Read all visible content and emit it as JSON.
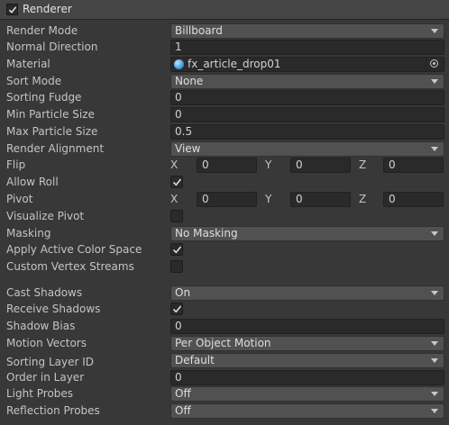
{
  "header": {
    "title": "Renderer",
    "checked": true
  },
  "rows": {
    "render_mode": {
      "label": "Render Mode",
      "value": "Billboard"
    },
    "normal_direction": {
      "label": "Normal Direction",
      "value": "1"
    },
    "material": {
      "label": "Material",
      "value": "fx_article_drop01",
      "icon": "material-sphere-icon"
    },
    "sort_mode": {
      "label": "Sort Mode",
      "value": "None"
    },
    "sorting_fudge": {
      "label": "Sorting Fudge",
      "value": "0"
    },
    "min_particle_size": {
      "label": "Min Particle Size",
      "value": "0"
    },
    "max_particle_size": {
      "label": "Max Particle Size",
      "value": "0.5"
    },
    "render_alignment": {
      "label": "Render Alignment",
      "value": "View"
    },
    "flip": {
      "label": "Flip",
      "x_label": "X",
      "x": "0",
      "y_label": "Y",
      "y": "0",
      "z_label": "Z",
      "z": "0"
    },
    "allow_roll": {
      "label": "Allow Roll",
      "checked": true
    },
    "pivot": {
      "label": "Pivot",
      "x_label": "X",
      "x": "0",
      "y_label": "Y",
      "y": "0",
      "z_label": "Z",
      "z": "0"
    },
    "visualize_pivot": {
      "label": "Visualize Pivot",
      "checked": false
    },
    "masking": {
      "label": "Masking",
      "value": "No Masking"
    },
    "apply_active_color_space": {
      "label": "Apply Active Color Space",
      "checked": true
    },
    "custom_vertex_streams": {
      "label": "Custom Vertex Streams",
      "checked": false
    },
    "cast_shadows": {
      "label": "Cast Shadows",
      "value": "On"
    },
    "receive_shadows": {
      "label": "Receive Shadows",
      "checked": true
    },
    "shadow_bias": {
      "label": "Shadow Bias",
      "value": "0"
    },
    "motion_vectors": {
      "label": "Motion Vectors",
      "value": "Per Object Motion"
    },
    "sorting_layer_id": {
      "label": "Sorting Layer ID",
      "value": "Default"
    },
    "order_in_layer": {
      "label": "Order in Layer",
      "value": "0"
    },
    "light_probes": {
      "label": "Light Probes",
      "value": "Off"
    },
    "reflection_probes": {
      "label": "Reflection Probes",
      "value": "Off"
    }
  }
}
